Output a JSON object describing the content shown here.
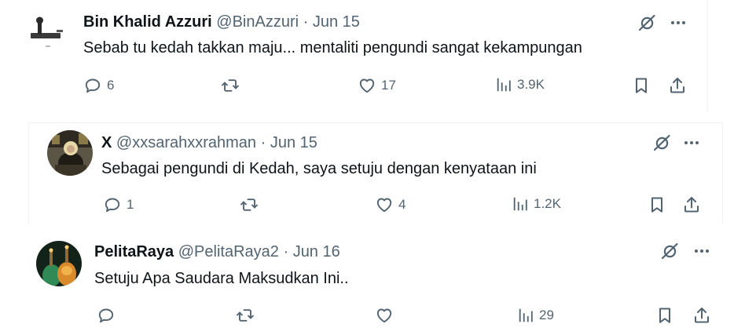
{
  "tweets": [
    {
      "name": "Bin Khalid Azzuri",
      "handle": "@BinAzzuri",
      "separator": "·",
      "date": "Jun 15",
      "text": "Sebab tu kedah takkan maju... mentaliti pengundi sangat kekampungan",
      "replies": "6",
      "reposts": "",
      "likes": "17",
      "views": "3.9K"
    },
    {
      "name": "X",
      "handle": "@xxsarahxxrahman",
      "separator": "·",
      "date": "Jun 15",
      "text": "Sebagai pengundi di Kedah, saya setuju dengan kenyataan ini",
      "replies": "1",
      "reposts": "",
      "likes": "4",
      "views": "1.2K"
    },
    {
      "name": "PelitaRaya",
      "handle": "@PelitaRaya2",
      "separator": "·",
      "date": "Jun 16",
      "text": "Setuju Apa Saudara Maksudkan Ini..",
      "replies": "",
      "reposts": "",
      "likes": "",
      "views": "29"
    }
  ],
  "icons": {
    "grok": "grok-icon",
    "more": "more-icon",
    "reply": "reply-icon",
    "repost": "repost-icon",
    "like": "like-icon",
    "views": "views-icon",
    "bookmark": "bookmark-icon",
    "share": "share-icon"
  },
  "colors": {
    "text": "#0f1419",
    "secondary": "#536471",
    "divider": "#eff3f4"
  }
}
